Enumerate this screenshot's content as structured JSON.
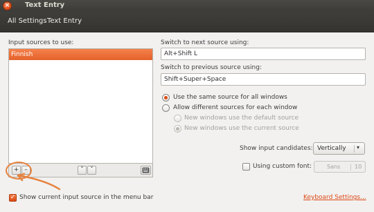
{
  "window": {
    "title": "Text Entry",
    "close_glyph": "×"
  },
  "toolbar": {
    "all_settings": "All Settings",
    "current": "Text Entry"
  },
  "sources": {
    "label": "Input sources to use:",
    "items": [
      "Finnish"
    ],
    "add": "+",
    "remove": "–",
    "up": "˄",
    "down": "˅"
  },
  "next_source": {
    "label": "Switch to next source using:",
    "value": "Alt+Shift L"
  },
  "prev_source": {
    "label": "Switch to previous source using:",
    "value": "Shift+Super+Space"
  },
  "mode": {
    "same": "Use the same source for all windows",
    "different": "Allow different sources for each window",
    "new_default": "New windows use the default source",
    "new_current": "New windows use the current source",
    "selected": "same"
  },
  "candidates": {
    "label": "Show input candidates:",
    "value": "Vertically"
  },
  "custom_font": {
    "label": "Using custom font:",
    "checked": false,
    "font": "Sans",
    "size": "10"
  },
  "menu_bar": {
    "label": "Show current input source in the menu bar",
    "checked": true
  },
  "keyboard_settings": "Keyboard Settings...",
  "colors": {
    "accent": "#dd4814",
    "annotation": "#e6823e",
    "titlebar": "#3c3b37"
  }
}
